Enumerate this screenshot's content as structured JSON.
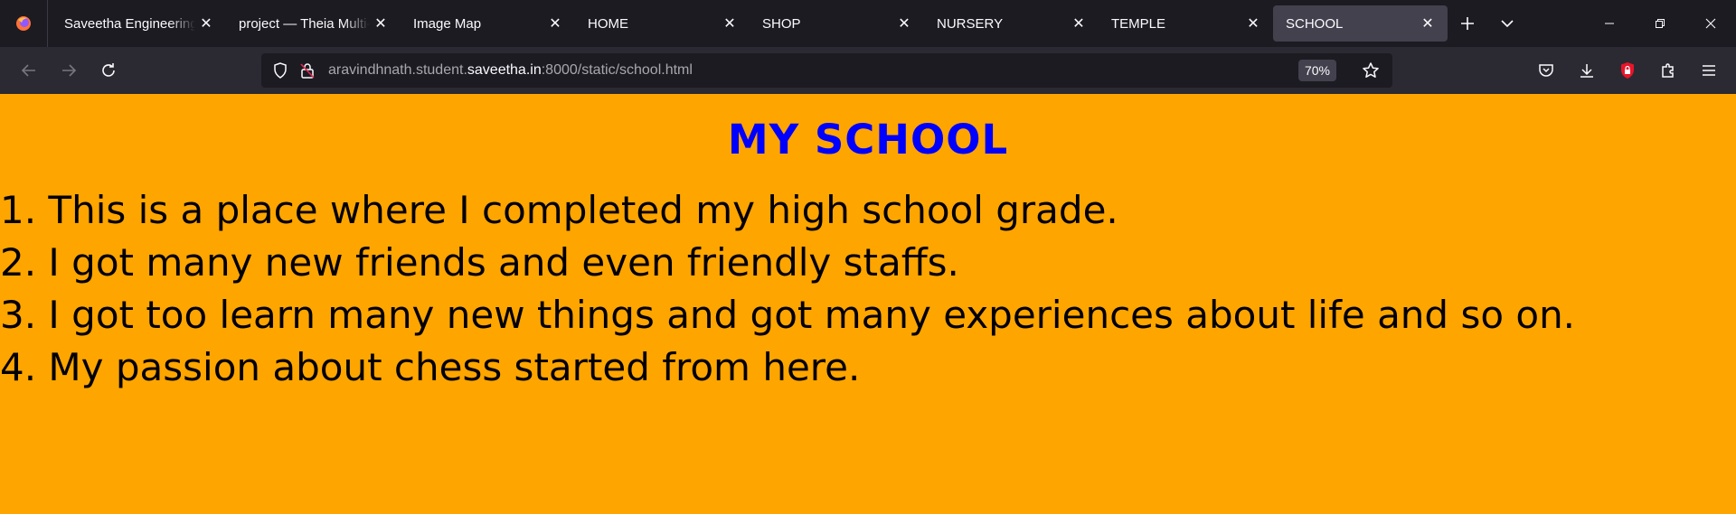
{
  "browser": {
    "tabs": [
      {
        "label": "Saveetha Engineering"
      },
      {
        "label": "project — Theia Multi-"
      },
      {
        "label": "Image Map"
      },
      {
        "label": "HOME"
      },
      {
        "label": "SHOP"
      },
      {
        "label": "NURSERY"
      },
      {
        "label": "TEMPLE"
      },
      {
        "label": "SCHOOL"
      }
    ],
    "url_prefix": "aravindhnath.student.",
    "url_domain": "saveetha.in",
    "url_suffix": ":8000/static/school.html",
    "zoom": "70%"
  },
  "page": {
    "title": "MY SCHOOL",
    "items": [
      "1. This is a place where I completed my high school grade.",
      "2. I got many new friends and even friendly staffs.",
      "3. I got too learn many new things and got many experiences about life and so on.",
      "4. My passion about chess started from here."
    ]
  }
}
